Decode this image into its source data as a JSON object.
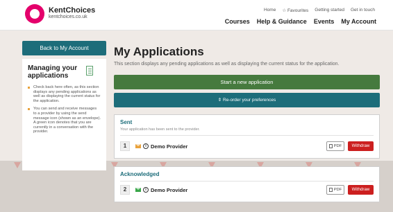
{
  "header": {
    "logo_name": "KentChoices",
    "logo_url": "kentchoices.co.uk",
    "top_links": [
      "Home",
      "☆ Favourites",
      "Getting started",
      "Get in touch"
    ],
    "main_links": [
      "Courses",
      "Help & Guidance",
      "Events",
      "My Account"
    ]
  },
  "sidebar": {
    "back_label": "Back to My Account",
    "title": "Managing your applications",
    "tips": [
      "Check back here often, as this section displays any pending applications as well as displaying the current status for the application.",
      "You can send and receive messages to a provider by using the send message icon (shown as an envelope). A green icon denotes that you are currently in a conversation with the provider."
    ]
  },
  "main": {
    "title": "My Applications",
    "description": "This section displays any pending applications as well as displaying the current status for the application.",
    "new_application_label": "Start a new application",
    "reorder_label": "⇕ Re-order your preferences"
  },
  "sections": [
    {
      "title": "Sent",
      "subtitle": "Your application has been sent to the provider.",
      "rows": [
        {
          "number": "1",
          "provider": "Demo Provider",
          "envelope_color": "#e9a23b",
          "pdf_label": "PDF",
          "withdraw_label": "Withdraw"
        }
      ]
    },
    {
      "title": "Acknowledged",
      "rows": [
        {
          "number": "2",
          "provider": "Demo Provider",
          "envelope_color": "#3aa74a",
          "pdf_label": "PDF",
          "withdraw_label": "Withdraw"
        }
      ]
    }
  ],
  "colors": {
    "brand_pink": "#e4006b",
    "teal": "#1d6d7a",
    "green": "#467a3e",
    "red": "#cc1f1f",
    "orange": "#e9a23b"
  }
}
